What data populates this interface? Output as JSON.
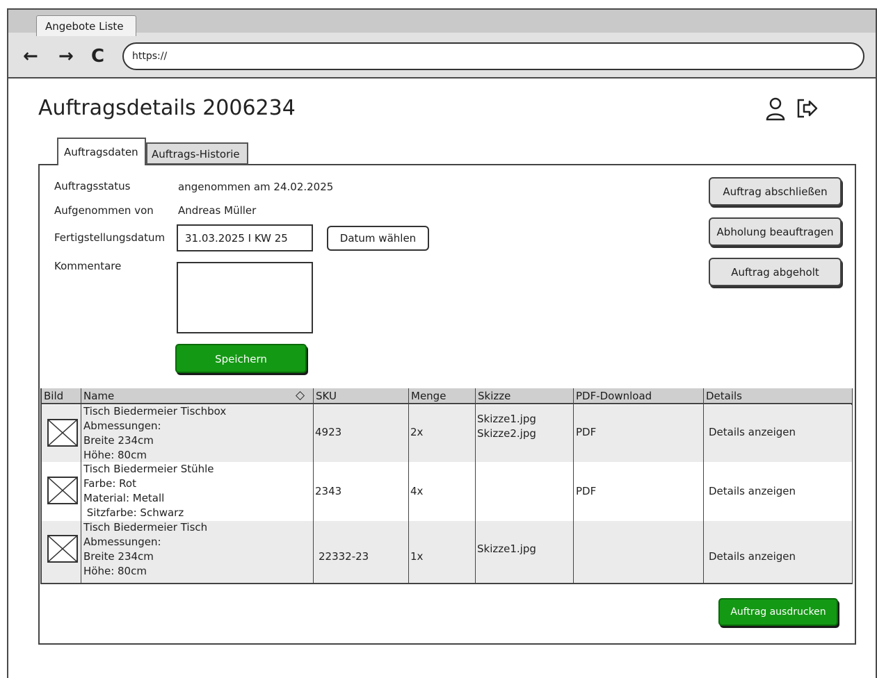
{
  "browser": {
    "tab_title": "Angebote Liste",
    "url": "https://",
    "back_icon": "←",
    "forward_icon": "→",
    "reload_icon": "C"
  },
  "header": {
    "title": "Auftragsdetails 2006234"
  },
  "tabs": [
    {
      "label": "Auftragsdaten",
      "active": true
    },
    {
      "label": "Auftrags-Historie",
      "active": false
    }
  ],
  "form": {
    "status_label": "Auftragsstatus",
    "status_value": "angenommen am 24.02.2025",
    "created_by_label": "Aufgenommen von",
    "created_by_value": "Andreas Müller",
    "completion_label": "Fertigstellungsdatum",
    "completion_value": "31.03.2025 I KW 25",
    "choose_date_label": "Datum wählen",
    "comments_label": "Kommentare",
    "save_label": "Speichern"
  },
  "actions": {
    "complete_label": "Auftrag abschließen",
    "pickup_label": "Abholung beauftragen",
    "picked_up_label": "Auftrag abgeholt",
    "print_label": "Auftrag ausdrucken"
  },
  "table": {
    "columns": [
      "Bild",
      "Name",
      "SKU",
      "Menge",
      "Skizze",
      "PDF-Download",
      "Details"
    ],
    "rows": [
      {
        "name_lines": [
          "Tisch Biedermeier Tischbox",
          "Abmessungen:",
          "Breite 234cm",
          "Höhe: 80cm"
        ],
        "sku": "4923",
        "qty": "2x",
        "sketch_lines": [
          "Skizze1.jpg",
          "Skizze2.jpg"
        ],
        "pdf": "PDF",
        "details": "Details anzeigen"
      },
      {
        "name_lines": [
          "Tisch Biedermeier Stühle",
          "Farbe: Rot",
          "Material: Metall",
          " Sitzfarbe: Schwarz"
        ],
        "sku": "2343",
        "qty": "4x",
        "sketch_lines": [],
        "pdf": "PDF",
        "details": "Details anzeigen"
      },
      {
        "name_lines": [
          "Tisch Biedermeier Tisch",
          "Abmessungen:",
          "Breite 234cm",
          "Höhe: 80cm"
        ],
        "sku": "22332-23",
        "qty": "1x",
        "sketch_lines": [
          "Skizze1.jpg"
        ],
        "pdf": "",
        "details": "Details anzeigen"
      }
    ]
  },
  "colors": {
    "primary_green": "#149914",
    "header_gray": "#cfcfcf",
    "row_alt": "#ebebeb"
  }
}
